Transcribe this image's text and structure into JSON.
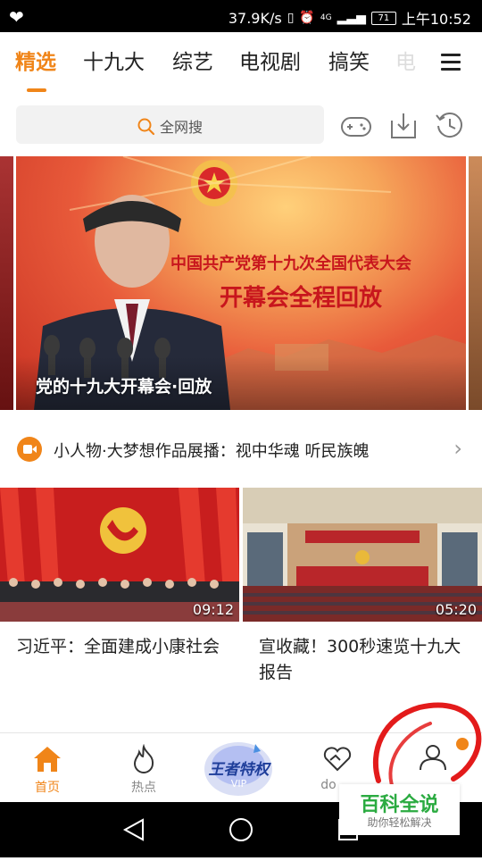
{
  "status_bar": {
    "net_speed": "37.9K/s",
    "signal_label": "4G",
    "battery": "71",
    "time": "上午10:52"
  },
  "tabs": [
    {
      "label": "精选",
      "active": true
    },
    {
      "label": "十九大"
    },
    {
      "label": "综艺"
    },
    {
      "label": "电视剧"
    },
    {
      "label": "搞笑"
    },
    {
      "label": "电"
    }
  ],
  "search": {
    "placeholder": "全网搜"
  },
  "toolbar": {
    "icons": [
      "gamepad-icon",
      "download-icon",
      "history-icon"
    ]
  },
  "banner": {
    "headline_line1": "中国共产党第十九次全国代表大会",
    "headline_line2": "开幕会全程回放",
    "caption": "党的十九大开幕会·回放"
  },
  "promo": {
    "text": "小人物·大梦想作品展播：视中华魂 听民族魄"
  },
  "cards": [
    {
      "title": "习近平：全面建成小康社会",
      "duration": "09:12"
    },
    {
      "title": "宣收藏！300秒速览十九大报告",
      "duration": "05:20"
    }
  ],
  "bottom_nav": {
    "home": "首页",
    "hot": "热点",
    "vip_badge": "王者特权",
    "vip_sub": "VIP",
    "dou": "do"
  },
  "watermark": {
    "title": "百科全说",
    "subtitle": "助你轻松解决"
  },
  "colors": {
    "accent": "#f08519",
    "annotation_red": "#e31b1b",
    "watermark_green": "#2bab41"
  }
}
